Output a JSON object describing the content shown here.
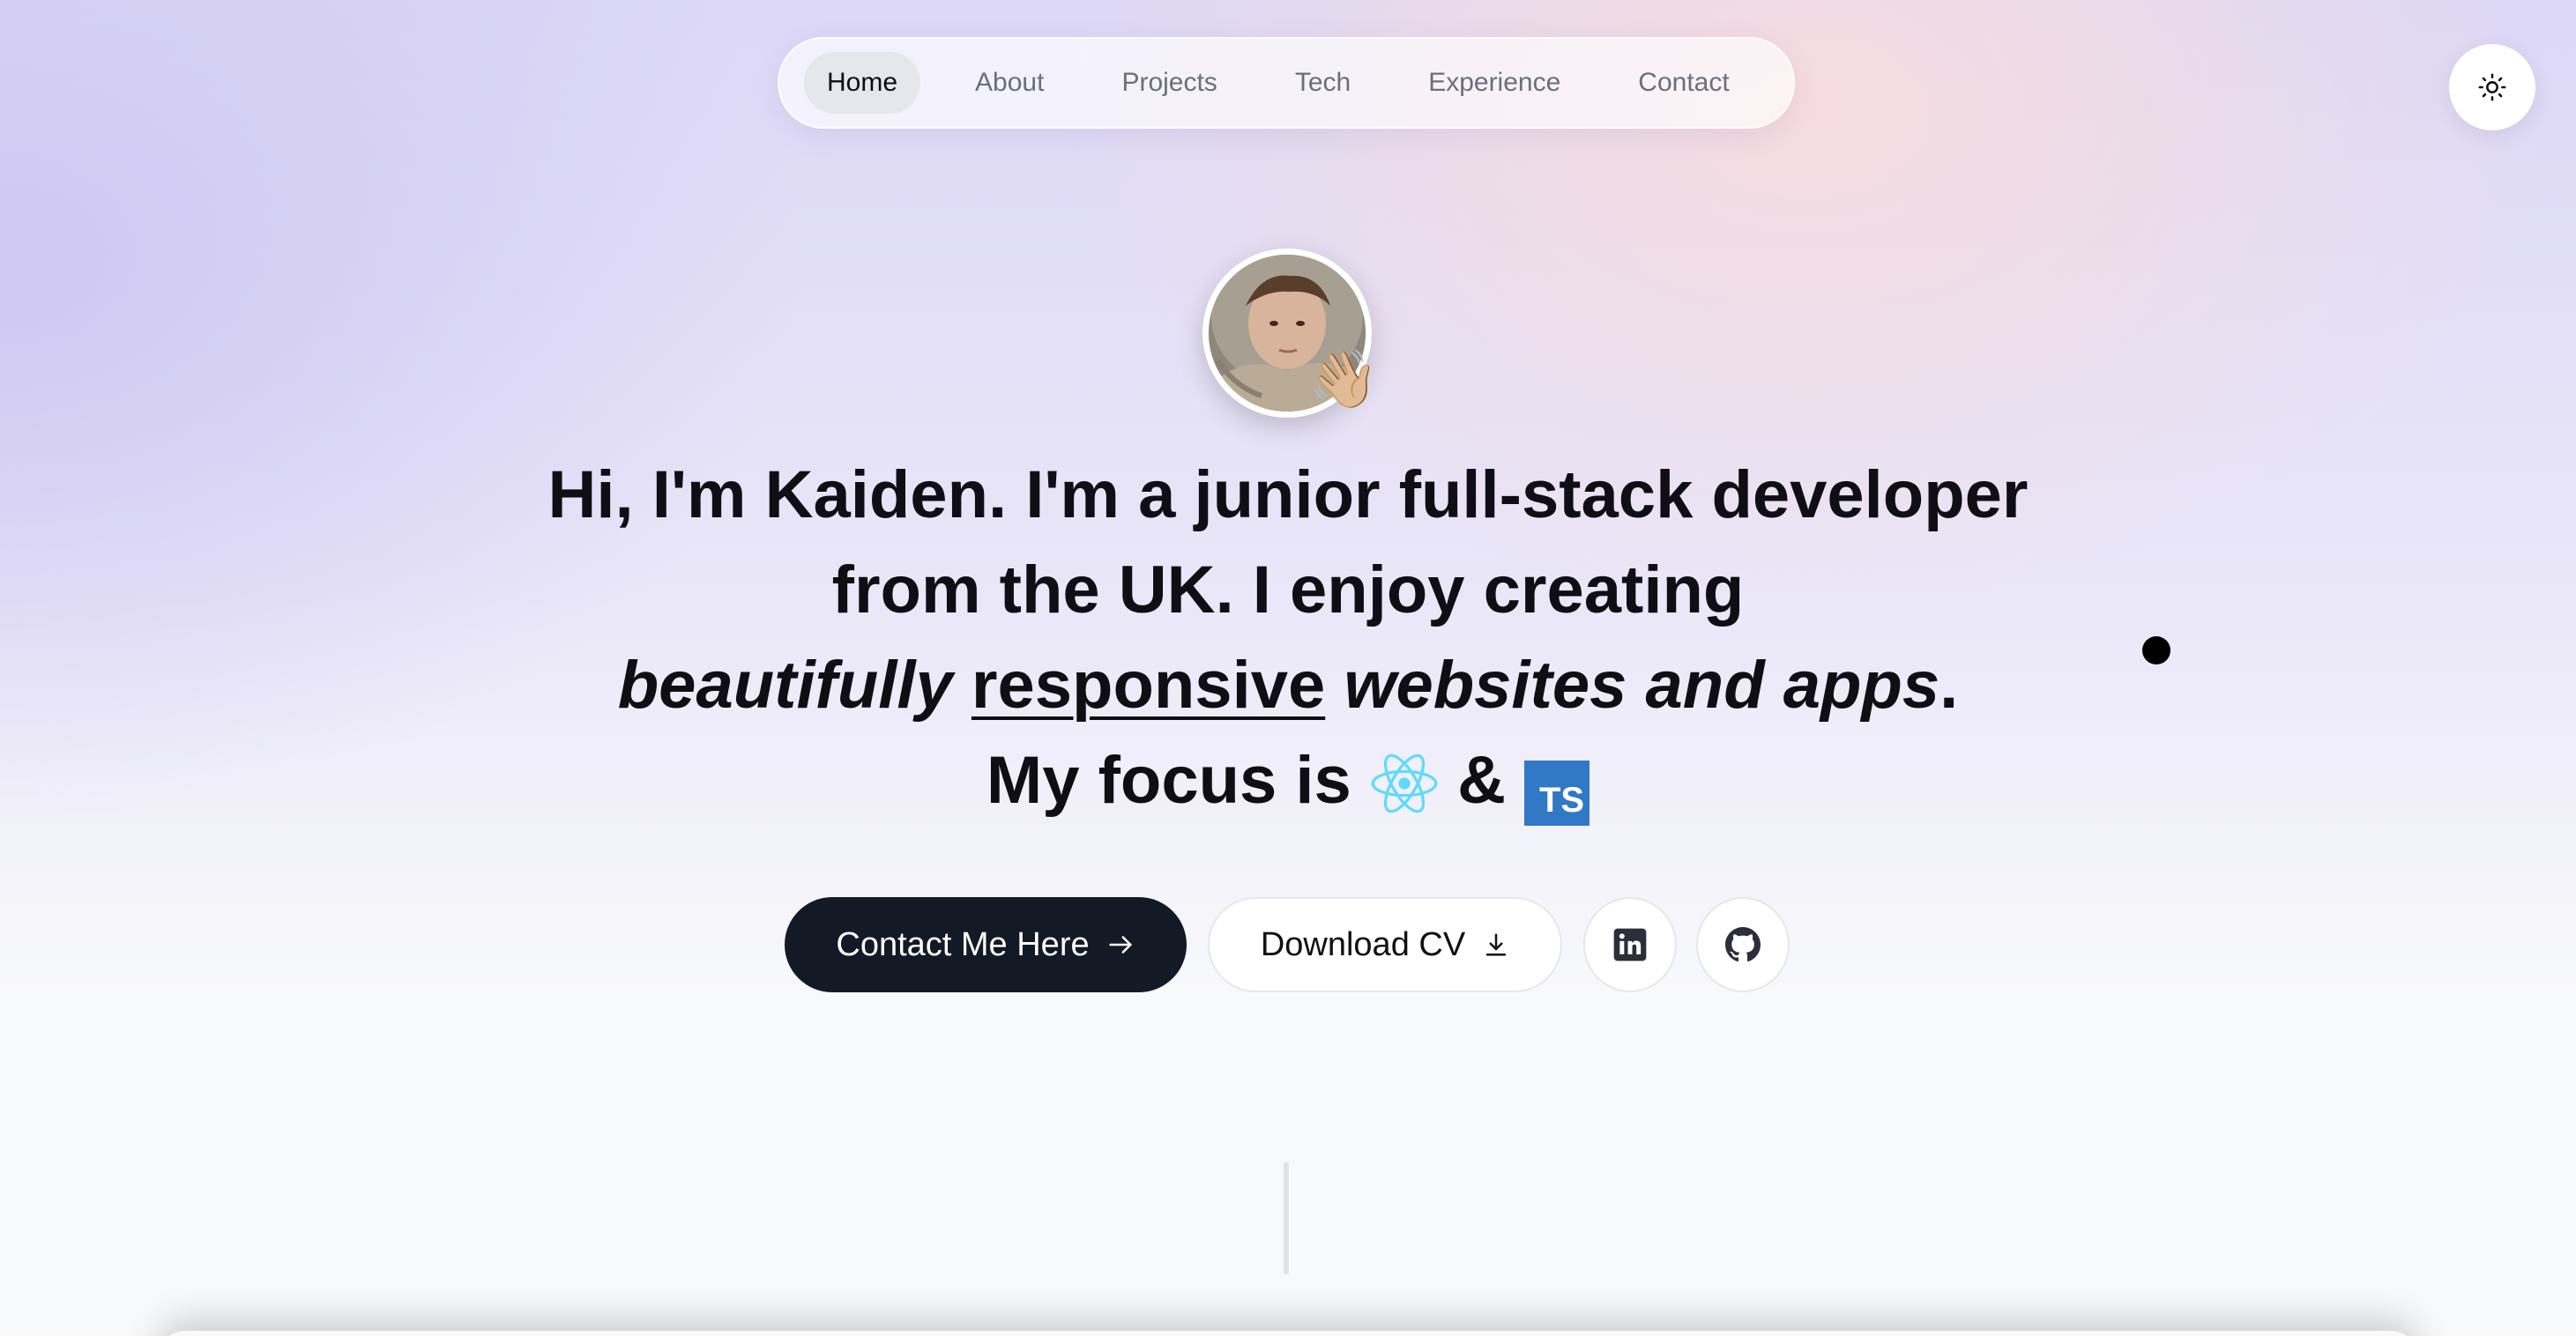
{
  "nav": {
    "items": [
      {
        "label": "Home",
        "active": true
      },
      {
        "label": "About"
      },
      {
        "label": "Projects"
      },
      {
        "label": "Tech"
      },
      {
        "label": "Experience"
      },
      {
        "label": "Contact"
      }
    ]
  },
  "theme_toggle": {
    "icon": "sun-icon"
  },
  "hero": {
    "avatar_icon": "profile-photo",
    "wave_emoji": "👋🏼",
    "headline": {
      "greeting": "Hi, I'm Kaiden.",
      "im_a": " I'm a ",
      "role": "junior full-stack developer",
      "from_the": " from the ",
      "country": "UK",
      "enjoy": ". I enjoy creating ",
      "beautifully": "beautifully",
      "responsive": "responsive",
      "websites": "websites and apps",
      "period": ".",
      "focus": "My focus is",
      "amp": "&",
      "ts_badge": "TS"
    }
  },
  "buttons": {
    "contact": "Contact Me Here",
    "download": "Download CV"
  },
  "colors": {
    "primary_button": "#141926",
    "react": "#61dafb",
    "typescript": "#3178c6"
  }
}
